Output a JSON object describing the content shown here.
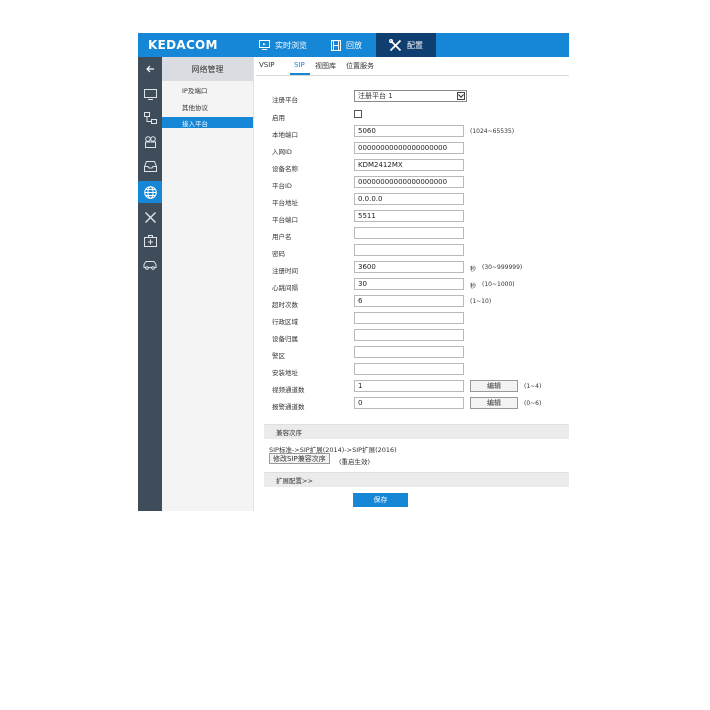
{
  "brand": "KEDACOM",
  "nav": {
    "tabs": [
      {
        "label": "实时浏览",
        "icon": "monitor-icon"
      },
      {
        "label": "回放",
        "icon": "film-icon"
      },
      {
        "label": "配置",
        "icon": "tools-icon"
      }
    ]
  },
  "rail": {
    "icons": [
      "back-arrow-icon",
      "monitor-icon",
      "network-icon",
      "camera-icon",
      "storage-icon",
      "globe-icon",
      "tools-icon",
      "medkit-icon",
      "vehicle-icon"
    ]
  },
  "sidemenu": {
    "header": "网络管理",
    "items": [
      "IP及端口",
      "其他协议",
      "接入平台"
    ]
  },
  "subtabs": [
    "VSIP",
    "SIP",
    "视图库",
    "位置服务"
  ],
  "form": {
    "platform_label": "注册平台",
    "platform_value": "注册平台 1",
    "enable_label": "启用",
    "local_port_label": "本地端口",
    "local_port_value": "5060",
    "local_port_hint": "(1024~65535)",
    "access_id_label": "入网ID",
    "access_id_value": "00000000000000000000",
    "device_name_label": "设备名称",
    "device_name_value": "KDM2412MX",
    "platform_id_label": "平台ID",
    "platform_id_value": "00000000000000000000",
    "platform_addr_label": "平台地址",
    "platform_addr_value": "0.0.0.0",
    "platform_port_label": "平台端口",
    "platform_port_value": "5511",
    "username_label": "用户名",
    "password_label": "密码",
    "expire_label": "注册时间",
    "expire_value": "3600",
    "expire_unit": "秒",
    "expire_hint": "(30~999999)",
    "heartbeat_label": "心跳间隔",
    "heartbeat_value": "30",
    "heartbeat_unit": "秒",
    "heartbeat_hint": "(10~1000)",
    "timeout_label": "超时次数",
    "timeout_value": "6",
    "timeout_hint": "(1~10)",
    "admin_area_label": "行政区域",
    "device_owner_label": "设备归属",
    "district_label": "警区",
    "install_addr_label": "安装地址",
    "video_ch_label": "视频通道数",
    "video_ch_value": "1",
    "video_ch_btn": "编辑",
    "video_ch_hint": "(1~4)",
    "alarm_ch_label": "报警通道数",
    "alarm_ch_value": "0",
    "alarm_ch_btn": "编辑",
    "alarm_ch_hint": "(0~6)"
  },
  "compat": {
    "section_title": "兼容次序",
    "order_text": "SIP标准->SIP扩展(2014)->SIP扩展(2016)",
    "modify_btn": "修改SIP兼容次序",
    "note": "(重启生效)"
  },
  "extended": {
    "section_title": "扩展配置>>"
  },
  "save_btn": "保存"
}
